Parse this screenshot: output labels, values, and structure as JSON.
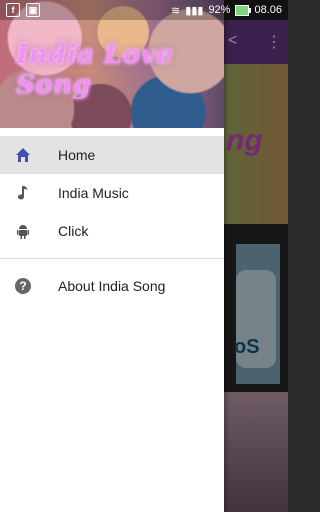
{
  "status_bar": {
    "battery_percent": "92%",
    "time": "08.06"
  },
  "background": {
    "banner_text": "ng",
    "card_text": "oS"
  },
  "drawer": {
    "header_title": "India Love Song",
    "items": [
      {
        "label": "Home",
        "icon": "home-icon"
      },
      {
        "label": "India Music",
        "icon": "music-note-icon"
      },
      {
        "label": "Click",
        "icon": "android-icon"
      }
    ],
    "secondary_items": [
      {
        "label": "About India Song",
        "icon": "help-icon"
      }
    ]
  },
  "colors": {
    "toolbar": "#6d3b8c",
    "home_icon": "#3f51b5",
    "active_item_bg": "#e3e3e3"
  }
}
